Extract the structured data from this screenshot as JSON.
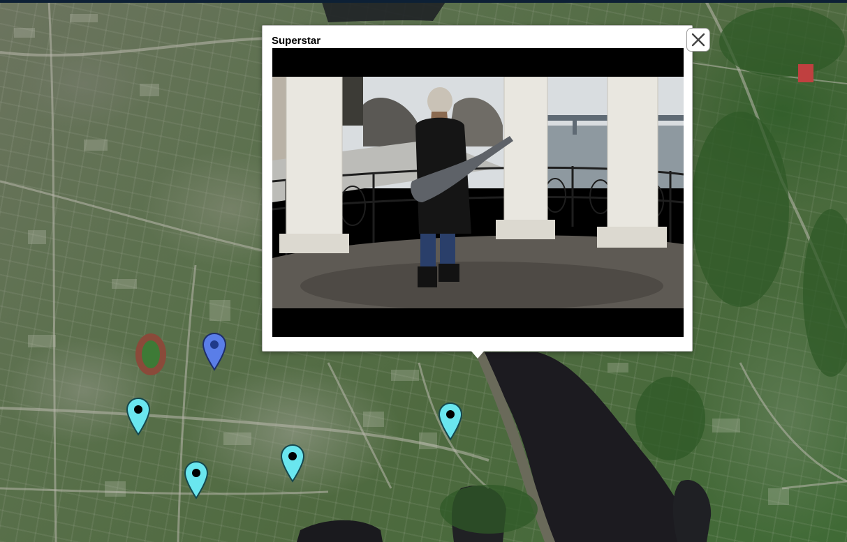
{
  "popup": {
    "title": "Superstar",
    "close_icon": "close-icon",
    "media": "video-player"
  },
  "markers": [
    {
      "id": "marker-selected",
      "color": "#5a7ee8",
      "state": "selected"
    },
    {
      "id": "marker-1",
      "color": "#6ae6ef",
      "state": "default"
    },
    {
      "id": "marker-2",
      "color": "#6ae6ef",
      "state": "default"
    },
    {
      "id": "marker-3",
      "color": "#6ae6ef",
      "state": "default"
    },
    {
      "id": "marker-4",
      "color": "#6ae6ef",
      "state": "default"
    }
  ],
  "map": {
    "style": "satellite",
    "river_color": "#1b1a1f"
  }
}
